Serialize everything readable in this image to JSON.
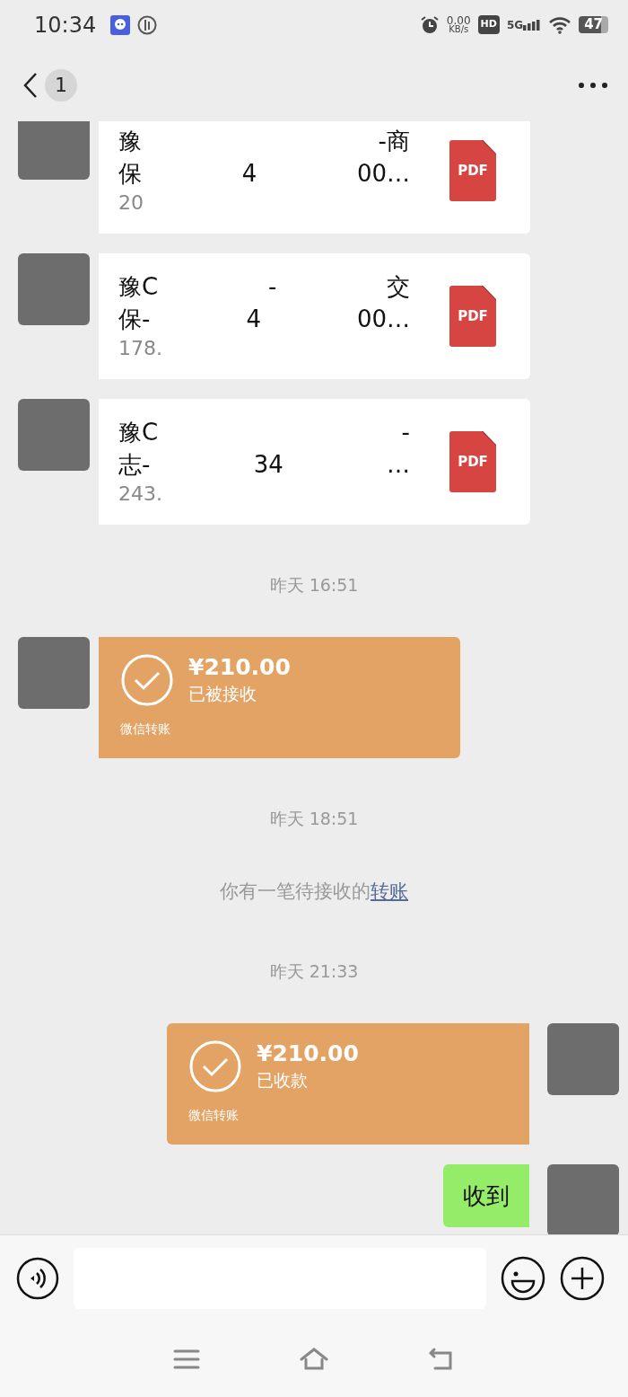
{
  "status_bar": {
    "time": "10:34",
    "net_speed": "0.00",
    "net_unit": "KB/s",
    "hd_badge": "HD",
    "network": "5G",
    "battery": "47"
  },
  "header": {
    "unread_count": "1"
  },
  "messages": [
    {
      "kind": "file",
      "outgoing": false,
      "name_lines": [
        [
          "豫",
          "-商"
        ],
        [
          "保",
          "4",
          "00…"
        ]
      ],
      "size": "20",
      "file_type": "PDF"
    },
    {
      "kind": "file",
      "outgoing": false,
      "name_lines": [
        [
          "豫C",
          "-",
          "交"
        ],
        [
          "保-",
          "4",
          "00…"
        ]
      ],
      "size": "178.",
      "file_type": "PDF"
    },
    {
      "kind": "file",
      "outgoing": false,
      "name_lines": [
        [
          "豫C",
          "-"
        ],
        [
          "志-",
          "34",
          "…"
        ]
      ],
      "size": "243.",
      "file_type": "PDF"
    },
    {
      "kind": "time",
      "text": "昨天 16:51"
    },
    {
      "kind": "transfer",
      "outgoing": false,
      "amount": "¥210.00",
      "status": "已被接收",
      "label": "微信转账"
    },
    {
      "kind": "time",
      "text": "昨天 18:51"
    },
    {
      "kind": "system",
      "text": "你有一笔待接收的",
      "link": "转账"
    },
    {
      "kind": "time",
      "text": "昨天 21:33"
    },
    {
      "kind": "transfer",
      "outgoing": true,
      "amount": "¥210.00",
      "status": "已收款",
      "label": "微信转账"
    },
    {
      "kind": "text",
      "outgoing": true,
      "text": "收到"
    }
  ]
}
